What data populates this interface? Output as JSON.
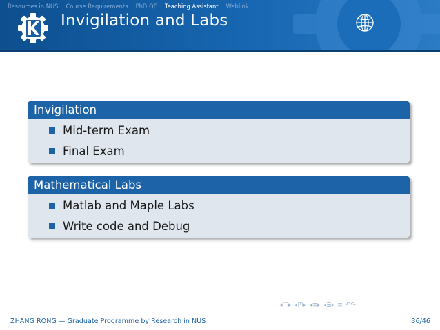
{
  "nav": {
    "items": [
      {
        "label": "Resources in NUS",
        "active": false
      },
      {
        "label": "Course Requirements",
        "active": false
      },
      {
        "label": "PhD QE",
        "active": false
      },
      {
        "label": "Teaching Assistant",
        "active": true
      },
      {
        "label": "Weblink",
        "active": false
      }
    ]
  },
  "slide": {
    "title": "Invigilation and Labs",
    "blocks": [
      {
        "title": "Invigilation",
        "items": [
          "Mid-term Exam",
          "Final Exam"
        ]
      },
      {
        "title": "Mathematical Labs",
        "items": [
          "Matlab and Maple Labs",
          "Write code and Debug"
        ]
      }
    ]
  },
  "footer": {
    "left": "ZHANG RONG — Graduate Programme by Research in NUS",
    "page": "36/46"
  },
  "colors": {
    "header_blue": "#1766b1",
    "block_title": "#1d63a8",
    "block_body": "#dfe6ee",
    "footer_text": "#1d63a8"
  },
  "icons": [
    "kde-logo-icon",
    "gear-icon",
    "globe-icon"
  ]
}
